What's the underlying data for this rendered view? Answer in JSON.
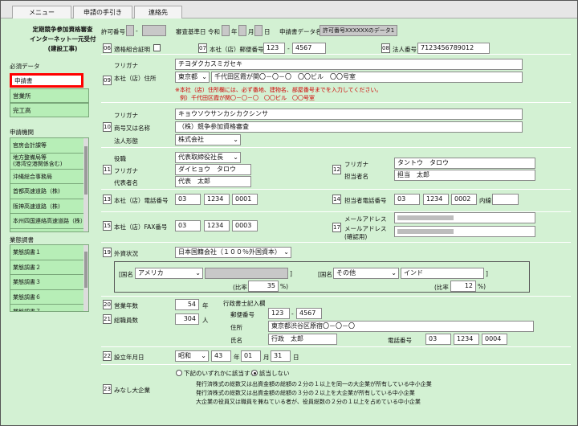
{
  "menu": {
    "tabs": [
      "メニュー",
      "申請の手引き",
      "連絡先"
    ]
  },
  "header": {
    "title_lines": [
      "定期競争参加資格審査",
      "インターネット一元受付",
      "(建設工事)"
    ],
    "permit_label": "許可番号",
    "permit_sep": "-",
    "review_label": "審査基準日",
    "era": "令和",
    "year_unit": "年",
    "month_unit": "月",
    "day_unit": "日",
    "data_name_label": "申請書データ名",
    "data_name_value": "許可番号XXXXXXのデータ1"
  },
  "sidebar": {
    "required_label": "必須データ",
    "required_items": [
      "申請書",
      "営業所",
      "完工高"
    ],
    "agencies_label": "申請機関",
    "agencies": [
      "官房会計課等",
      "地方整備局等\n(港湾空港関係含む)",
      "沖縄総合事務局",
      "首都高速道路（株)",
      "阪神高速道路（株)",
      "本州四国連絡高速道路（株）"
    ],
    "survey_label": "業態調書",
    "surveys": [
      "業態調書１",
      "業態調書２",
      "業態調書３",
      "業態調書６",
      "業態調書７"
    ]
  },
  "fields": {
    "f06": {
      "num": "06",
      "label": "適格組合証明"
    },
    "f07": {
      "num": "07",
      "label": "本社（店）郵便番号",
      "zip1": "123",
      "zip2": "4567"
    },
    "f08": {
      "num": "08",
      "label": "法人番号",
      "value": "7123456789012"
    },
    "f09": {
      "num": "09",
      "label": "本社（店）住所",
      "kana_label": "フリガナ",
      "kana": "チヨダクカスミガセキ",
      "pref": "東京都",
      "address": "千代田区霞が関〇－〇－〇　〇〇ビル　〇〇号室",
      "note1": "※本社（店）住所欄には、必ず番地、建物名、部屋番号までを入力してください。",
      "note2": "例）千代田区霞が関〇－〇－〇　〇〇ビル　〇〇号室"
    },
    "f10": {
      "num": "10",
      "label": "商号又は名称",
      "kana_label": "フリガナ",
      "kana": "キョウソウサンカシカクシンサ",
      "value": "（株）競争参加資格審査",
      "form_label": "法人形態",
      "form": "株式会社"
    },
    "f11": {
      "num": "11",
      "role_label": "役職",
      "role": "代表取締役社長",
      "kana_label": "フリガナ",
      "kana": "ダイヒョウ　タロウ",
      "label": "代表者名",
      "value": "代表　太郎"
    },
    "f12": {
      "num": "12",
      "kana_label": "フリガナ",
      "kana": "タントウ　タロウ",
      "label": "担当者名",
      "value": "担当　太郎"
    },
    "f13": {
      "num": "13",
      "label": "本社（店）電話番号",
      "t1": "03",
      "t2": "1234",
      "t3": "0001"
    },
    "f14": {
      "num": "14",
      "label": "担当者電話番号",
      "t1": "03",
      "t2": "1234",
      "t3": "0002",
      "ext_label": "内線",
      "ext": ""
    },
    "f15": {
      "num": "15",
      "label": "本社（店）FAX番号",
      "t1": "03",
      "t2": "1234",
      "t3": "0003"
    },
    "f17": {
      "num": "17",
      "label": "メールアドレス",
      "label2": "メールアドレス\n(確認用)"
    },
    "f19": {
      "num": "19",
      "label": "外資状況",
      "value": "日本国籍会社（１００％外国資本）",
      "country_label": "[国名",
      "country": "アメリカ",
      "country2": "その他",
      "country2_text": "インド",
      "bracket_close": "]",
      "ratio_label": "(比率",
      "ratio1": "35",
      "ratio2": "12",
      "pct": "%)"
    },
    "f20": {
      "num": "20",
      "label": "営業年数",
      "value": "54",
      "unit": "年"
    },
    "f21": {
      "num": "21",
      "label": "総職員数",
      "value": "304",
      "unit": "人"
    },
    "scrivener": {
      "title": "行政書士記入欄",
      "zip_label": "郵便番号",
      "zip1": "123",
      "zip2": "4567",
      "addr_label": "住所",
      "addr": "東京都渋谷区原宿〇－〇－〇",
      "name_label": "氏名",
      "name": "行政　太郎",
      "tel_label": "電話番号",
      "t1": "03",
      "t2": "1234",
      "t3": "0004"
    },
    "f22": {
      "num": "22",
      "label": "設立年月日",
      "era": "昭和",
      "y": "43",
      "m": "01",
      "d": "31",
      "yu": "年",
      "mu": "月",
      "du": "日"
    },
    "f23": {
      "num": "23",
      "label": "みなし大企業",
      "opt1": "下記のいずれかに該当する",
      "opt2": "該当しない",
      "line1": "発行済株式の総数又は出資金額の総額の２分の１以上を同一の大企業が所有している中小企業",
      "line2": "発行済株式の総数又は出資金額の総額の３分の２以上を大企業が所有している中小企業",
      "line3": "大企業の役員又は職員を兼ねている者が、役員総数の２分の１以上を占めている中小企業"
    }
  },
  "colors": {
    "background": "#d3f1d3",
    "highlight": "#ff0000",
    "note": "#d00000"
  }
}
